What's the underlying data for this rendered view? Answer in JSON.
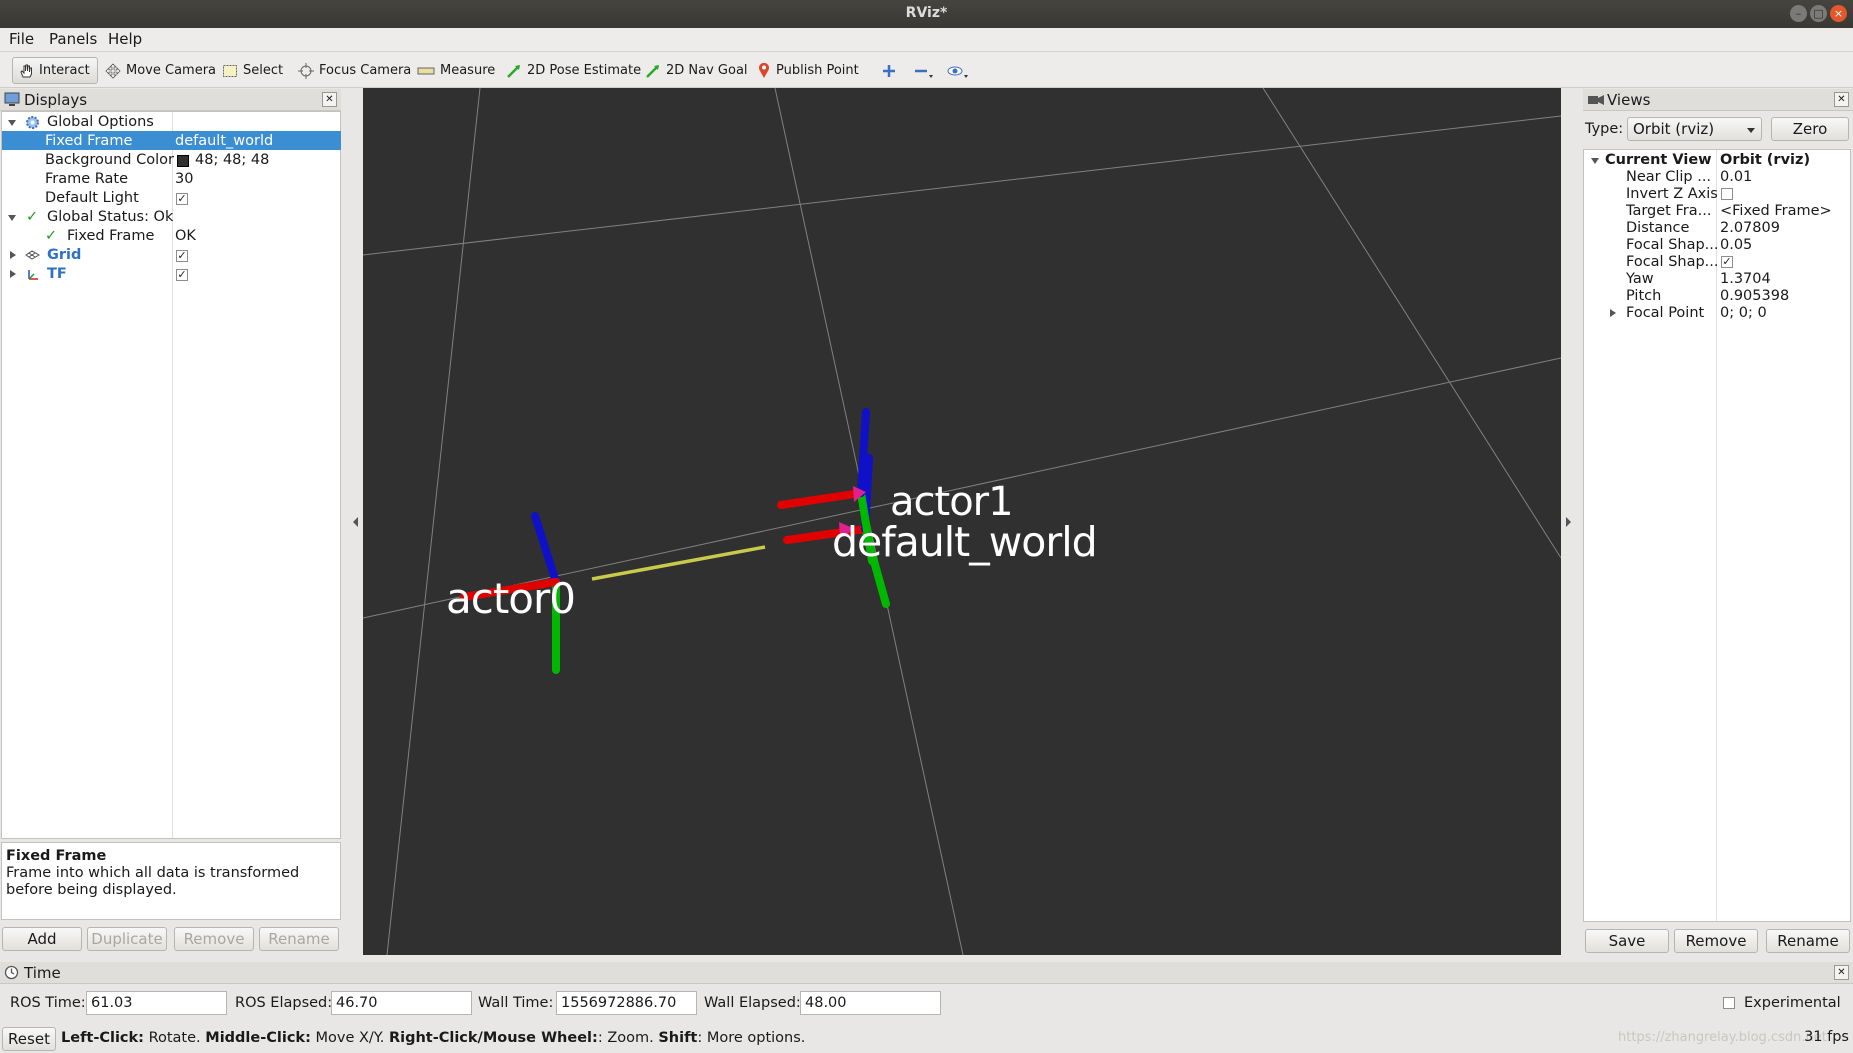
{
  "window": {
    "title": "RViz*"
  },
  "menubar": {
    "file": "File",
    "panels": "Panels",
    "help": "Help"
  },
  "toolbar": {
    "interact": "Interact",
    "move_camera": "Move Camera",
    "select": "Select",
    "focus_camera": "Focus Camera",
    "measure": "Measure",
    "pose_estimate": "2D Pose Estimate",
    "nav_goal": "2D Nav Goal",
    "publish_point": "Publish Point"
  },
  "displays": {
    "title": "Displays",
    "rows": {
      "global_options": "Global Options",
      "fixed_frame_label": "Fixed Frame",
      "fixed_frame_value": "default_world",
      "background_color_label": "Background Color",
      "background_color_value": "48; 48; 48",
      "frame_rate_label": "Frame Rate",
      "frame_rate_value": "30",
      "default_light_label": "Default Light",
      "global_status": "Global Status: Ok",
      "status_fixed_frame": "Fixed Frame",
      "status_fixed_frame_value": "OK",
      "grid": "Grid",
      "tf": "TF"
    },
    "checks": {
      "default_light": true,
      "grid": true,
      "tf": true
    },
    "description": {
      "title": "Fixed Frame",
      "text": "Frame into which all data is transformed before being displayed."
    },
    "buttons": {
      "add": "Add",
      "duplicate": "Duplicate",
      "remove": "Remove",
      "rename": "Rename"
    }
  },
  "scene": {
    "background": "#303030",
    "frames": [
      "actor0",
      "actor1",
      "default_world"
    ],
    "axis_colors": {
      "x": "#e00000",
      "y": "#00c000",
      "z": "#1010c8"
    },
    "link_color": "#c9c94a"
  },
  "views": {
    "title": "Views",
    "type_label": "Type:",
    "type_value": "Orbit (rviz)",
    "zero": "Zero",
    "current_view_label": "Current View",
    "current_view_value": "Orbit (rviz)",
    "props": [
      {
        "label": "Near Clip ...",
        "value": "0.01"
      },
      {
        "label": "Invert Z Axis",
        "value": ""
      },
      {
        "label": "Target Fra...",
        "value": "<Fixed Frame>"
      },
      {
        "label": "Distance",
        "value": "2.07809"
      },
      {
        "label": "Focal Shap...",
        "value": "0.05"
      },
      {
        "label": "Focal Shap...",
        "value": ""
      },
      {
        "label": "Yaw",
        "value": "1.3704"
      },
      {
        "label": "Pitch",
        "value": "0.905398"
      },
      {
        "label": "Focal Point",
        "value": "0; 0; 0"
      }
    ],
    "checks": {
      "invert_z": false,
      "focal_shape_fixed": true
    },
    "buttons": {
      "save": "Save",
      "remove": "Remove",
      "rename": "Rename"
    }
  },
  "time": {
    "title": "Time",
    "ros_time_label": "ROS Time:",
    "ros_time": "61.03",
    "ros_elapsed_label": "ROS Elapsed:",
    "ros_elapsed": "46.70",
    "wall_time_label": "Wall Time:",
    "wall_time": "1556972886.70",
    "wall_elapsed_label": "Wall Elapsed:",
    "wall_elapsed": "48.00",
    "experimental": "Experimental",
    "experimental_checked": false
  },
  "statusbar": {
    "reset": "Reset",
    "left_click": "Left-Click:",
    "left_click_action": "Rotate.",
    "middle_click": "Middle-Click:",
    "middle_click_action": "Move X/Y.",
    "right_click": "Right-Click/Mouse Wheel:",
    "right_click_action": ": Zoom.",
    "shift": "Shift",
    "shift_action": ": More options.",
    "watermark": "https://zhangrelay.blog.csdn.net",
    "fps": "31 fps"
  }
}
